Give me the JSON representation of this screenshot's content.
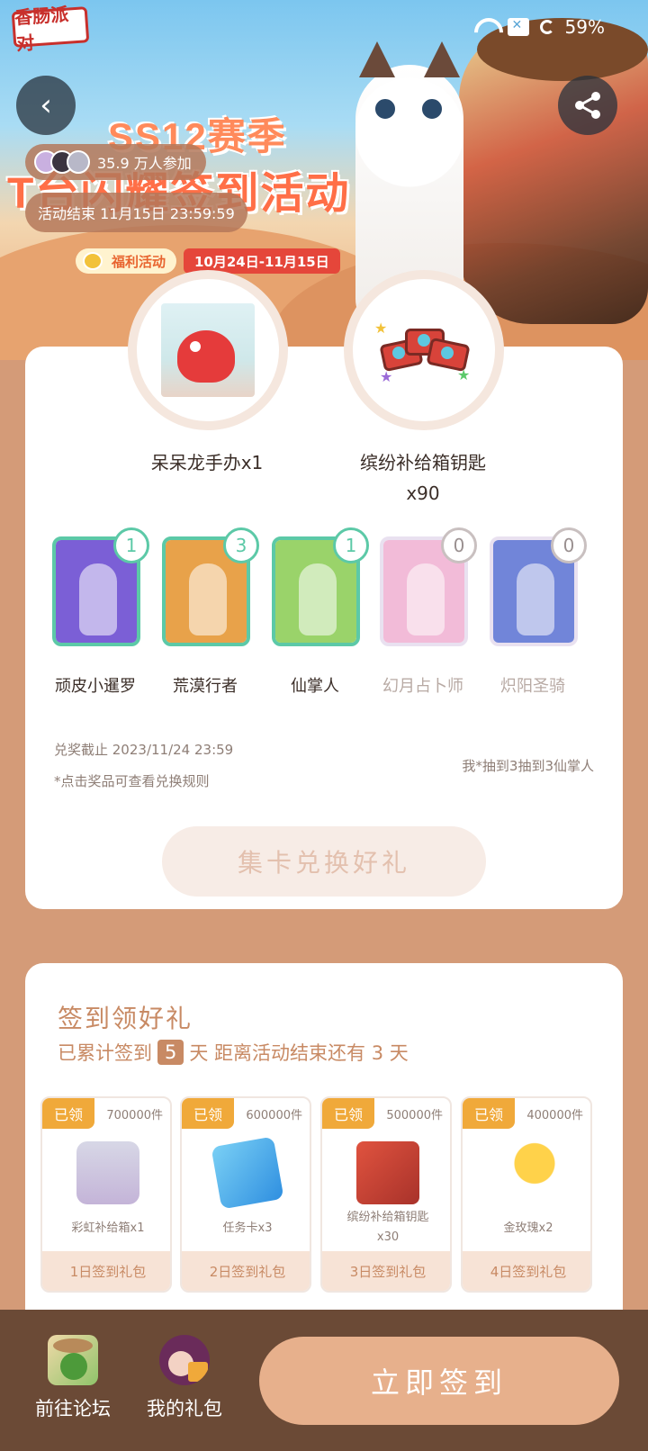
{
  "status_bar": {
    "battery_text": "59%"
  },
  "hero": {
    "logo_text": "香肠派对",
    "season_title": "SS12赛季",
    "event_title": "T台闪耀签到活动",
    "welfare_label": "福利活动",
    "date_range": "10月24日-11月15日",
    "participants_text": "35.9 万人参加",
    "end_time_text": "活动结束 11月15日 23:59:59"
  },
  "prizes": [
    {
      "label": "呆呆龙手办x1",
      "icon": "dragon-figure-icon"
    },
    {
      "label": "缤纷补给箱钥匙",
      "label2": "x90",
      "icon": "supply-key-icon"
    }
  ],
  "cards": [
    {
      "name": "顽皮小暹罗",
      "count": "1",
      "collected": true,
      "bg": "#7b5fd6"
    },
    {
      "name": "荒漠行者",
      "count": "3",
      "collected": true,
      "bg": "#e8a24a"
    },
    {
      "name": "仙掌人",
      "count": "1",
      "collected": true,
      "bg": "#9ad36a"
    },
    {
      "name": "幻月占卜师",
      "count": "0",
      "collected": false,
      "bg": "#f2b8d6"
    },
    {
      "name": "炽阳圣骑",
      "count": "0",
      "collected": false,
      "bg": "#6a7fd8"
    }
  ],
  "redeem": {
    "deadline": "兑奖截止 2023/11/24 23:59",
    "rule_note": "*点击奖品可查看兑换规则",
    "my_draw": "我*抽到3抽到3仙掌人",
    "button_label": "集卡兑换好礼"
  },
  "signin": {
    "title": "签到领好礼",
    "sub_prefix": "已累计签到",
    "days": "5",
    "sub_suffix": "天 距离活动结束还有 3 天",
    "gifts": [
      {
        "tag": "已领",
        "stock": "700000件",
        "name": "彩虹补给箱x1",
        "footer": "1日签到礼包",
        "icon": "rainbow-box-icon"
      },
      {
        "tag": "已领",
        "stock": "600000件",
        "name": "任务卡x3",
        "footer": "2日签到礼包",
        "icon": "task-card-icon"
      },
      {
        "tag": "已领",
        "stock": "500000件",
        "name": "缤纷补给箱钥匙",
        "name2": "x30",
        "footer": "3日签到礼包",
        "icon": "supply-key-icon"
      },
      {
        "tag": "已领",
        "stock": "400000件",
        "name": "金玫瑰x2",
        "footer": "4日签到礼包",
        "icon": "gold-rose-icon"
      }
    ]
  },
  "bottom": {
    "forum_label": "前往论坛",
    "gifts_label": "我的礼包",
    "signin_label": "立即签到"
  }
}
